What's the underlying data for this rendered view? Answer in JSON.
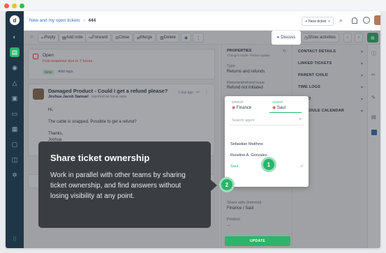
{
  "colors": {
    "accent": "#2ab56b",
    "sidebar": "#1f3648",
    "danger": "#e5484d"
  },
  "window": {
    "dots": [
      "#ff5f57",
      "#febc2e",
      "#28c840"
    ]
  },
  "sidebar": {
    "icons": [
      "app-logo-icon",
      "dashboard-icon",
      "tickets-icon",
      "contacts-icon",
      "alerts-icon",
      "solutions-icon",
      "forums-icon",
      "archive-icon",
      "chat-icon",
      "database-icon",
      "settings-icon",
      "apps-grid-icon"
    ]
  },
  "topbar": {
    "breadcrumb_link": "New and my open tickets",
    "breadcrumb_sep": "›",
    "ticket_id": "444",
    "new_ticket": "+ New ticket",
    "new_ticket_caret": "▾"
  },
  "toolbar": {
    "reply": "Reply",
    "add_note": "Add note",
    "forward": "Forward",
    "close": "Close",
    "merge": "Merge",
    "delete": "Delete",
    "more": "⋮",
    "discuss": "Discuss",
    "show_activities": "Show activities"
  },
  "status_card": {
    "status": "Open",
    "response_due": "First response due in 7 hours",
    "tag_new": "NEW",
    "add_tags": "Add tags"
  },
  "ticket": {
    "subject": "Damaged Product - Could I get a refund please?",
    "author": "Joshua Jacob Samuel",
    "reported_via": "reported an issue",
    "via_badge": "WEB",
    "time": "1 day ago",
    "body": [
      "Hi,",
      "The cable is snapped. Possible to get a refund?",
      "Thanks,",
      "Joshua"
    ]
  },
  "properties": {
    "title": "PROPERTIES",
    "subtitle": "Changes made. Please update",
    "type_label": "Type",
    "type_value": "Returns and refunds",
    "returned_label": "Returned/refund issue",
    "returned_value": "Refund not initiated",
    "share_label": "Share with (Internal)",
    "share_value": "Finance / Saul",
    "product_label": "Product",
    "product_value": "...",
    "update": "UPDATE"
  },
  "agent_dropdown": {
    "group_header": "GROUP",
    "group_value": "Finance",
    "agent_header": "AGENT",
    "agent_value": "Saul",
    "search_placeholder": "Search agent",
    "options": [
      "Sebastian Matthew",
      "Roseline A. Gonzales",
      "Saul"
    ],
    "selected": "Saul"
  },
  "side_panel": {
    "sections": [
      "CONTACT DETAILS",
      "LINKED TICKETS",
      "PARENT CHILD",
      "TIME LOGS",
      "TO-DO",
      "SCHEDULE CALENDAR"
    ]
  },
  "tooltip": {
    "title": "Share ticket ownership",
    "body": "Work in parallel with other teams by sharing ticket ownership, and find answers without losing visibility at any point."
  },
  "steps": {
    "one": "1",
    "two": "2"
  }
}
